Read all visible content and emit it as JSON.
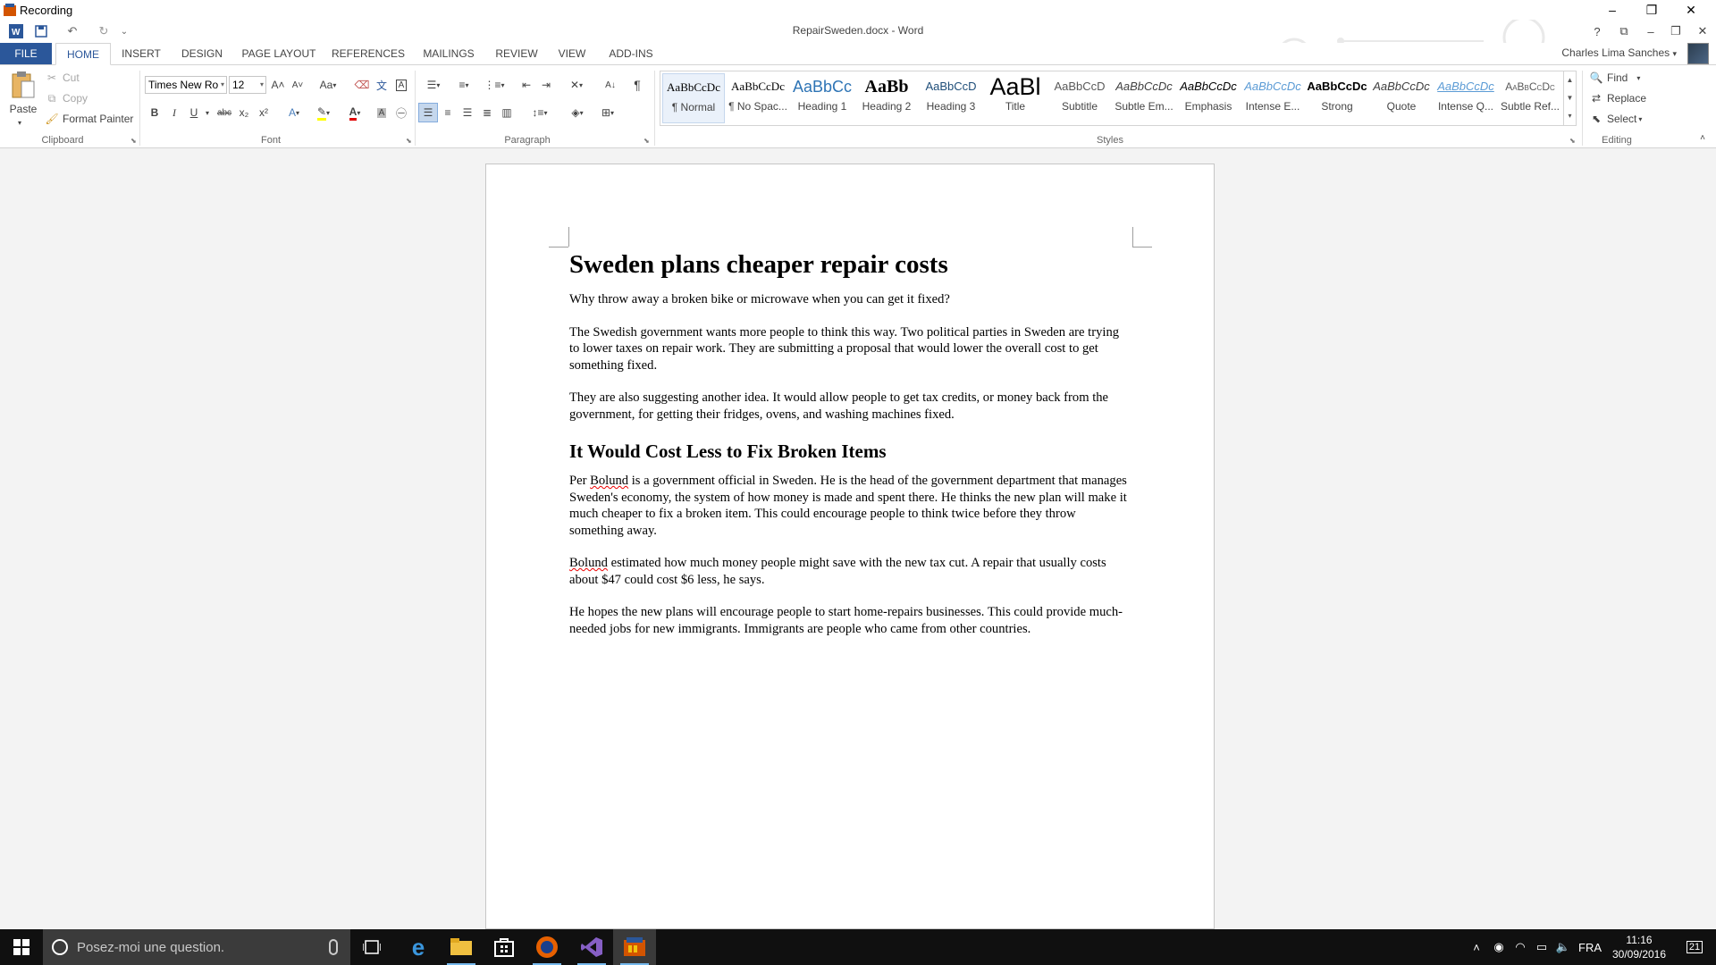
{
  "recording": {
    "title": "Recording"
  },
  "window": {
    "title": "RepairSweden.docx - Word"
  },
  "qat": {
    "undo": "↶",
    "redo": "↻",
    "customize": "⌄"
  },
  "titlebar": {
    "help": "?",
    "ribbon_options": "⧉",
    "minimize": "–",
    "restore": "❐",
    "close": "✕"
  },
  "tabs": [
    "FILE",
    "HOME",
    "INSERT",
    "DESIGN",
    "PAGE LAYOUT",
    "REFERENCES",
    "MAILINGS",
    "REVIEW",
    "VIEW",
    "ADD-INS"
  ],
  "user": {
    "name": "Charles Lima Sanches"
  },
  "clipboard": {
    "paste": "Paste",
    "cut": "Cut",
    "copy": "Copy",
    "format_painter": "Format Painter",
    "label": "Clipboard"
  },
  "font": {
    "name": "Times New Ro",
    "size": "12",
    "label": "Font",
    "grow": "A˄",
    "shrink": "A˅",
    "case": "Aa",
    "bold": "B",
    "italic": "I",
    "underline": "U",
    "strike": "abc",
    "sub": "x₂",
    "sup": "x²"
  },
  "paragraph": {
    "label": "Paragraph",
    "pilcrow": "¶",
    "sort": "A↓"
  },
  "styles": {
    "label": "Styles",
    "items": [
      {
        "sample": "AaBbCcDc",
        "name": "¶ Normal"
      },
      {
        "sample": "AaBbCcDc",
        "name": "¶ No Spac..."
      },
      {
        "sample": "AaBbCc",
        "name": "Heading 1"
      },
      {
        "sample": "AaBb",
        "name": "Heading 2"
      },
      {
        "sample": "AaBbCcD",
        "name": "Heading 3"
      },
      {
        "sample": "AaBl",
        "name": "Title"
      },
      {
        "sample": "AaBbCcD",
        "name": "Subtitle"
      },
      {
        "sample": "AaBbCcDc",
        "name": "Subtle Em..."
      },
      {
        "sample": "AaBbCcDc",
        "name": "Emphasis"
      },
      {
        "sample": "AaBbCcDc",
        "name": "Intense E..."
      },
      {
        "sample": "AaBbCcDc",
        "name": "Strong"
      },
      {
        "sample": "AaBbCcDc",
        "name": "Quote"
      },
      {
        "sample": "AaBbCcDc",
        "name": "Intense Q..."
      },
      {
        "sample": "AaBbCcDc",
        "name": "Subtle Ref..."
      }
    ]
  },
  "editing": {
    "label": "Editing",
    "find": "Find",
    "replace": "Replace",
    "select": "Select"
  },
  "document": {
    "title": "Sweden plans cheaper repair costs",
    "p1": "Why throw away a broken bike or microwave when you can get it fixed?",
    "p2": "The Swedish government wants more people to think this way. Two political parties in Sweden are trying to lower taxes on repair work. They are submitting a proposal that would lower the overall cost to get something fixed.",
    "p3": "They are also suggesting another idea. It would allow people to get tax credits, or money back from the government, for getting their fridges, ovens, and washing machines fixed.",
    "heading2": "It Would Cost Less to Fix Broken Items",
    "p4_pre": "Per ",
    "p4_name": "Bolund",
    "p4_post": " is a government official in Sweden. He is the head of the government department that manages Sweden's economy, the system of how money is made and spent there. He thinks the new plan will make it much cheaper to fix a broken item. This could encourage people to think twice before they throw something away.",
    "p5_name": "Bolund",
    "p5_post": " estimated how much money people might save with the new tax cut. A repair that usually costs about $47 could cost $6 less, he says.",
    "p6": "He hopes the new plans will encourage people to start home-repairs businesses. This could provide much-needed jobs for new immigrants. Immigrants are people who came from other countries."
  },
  "taskbar": {
    "search_placeholder": "Posez-moi une question.",
    "language": "FRA",
    "time": "11:16",
    "date": "30/09/2016",
    "notifications": "21"
  }
}
